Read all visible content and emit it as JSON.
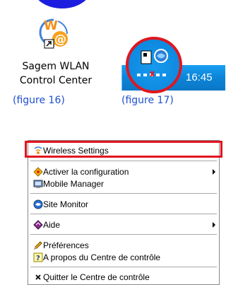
{
  "desktop_shortcut": {
    "label_line1": "Sagem WLAN",
    "label_line2": "Control Center",
    "icon": "wlan-shortcut-icon"
  },
  "captions": {
    "fig16": "(figure 16)",
    "fig17": "(figure 17)"
  },
  "tray": {
    "time": "16:45",
    "icon": "wlan-tray-icon"
  },
  "menu": {
    "items": [
      {
        "label": "Wireless Settings",
        "icon": "wireless-settings-icon"
      },
      {
        "label": "Activer la configuration",
        "icon": "activate-config-icon",
        "submenu": true
      },
      {
        "label": "Mobile Manager",
        "icon": "mobile-manager-icon"
      },
      {
        "label": "Site Monitor",
        "icon": "site-monitor-icon"
      },
      {
        "label": "Aide",
        "icon": "help-book-icon",
        "submenu": true
      },
      {
        "label": "Préférences",
        "icon": "pencil-icon"
      },
      {
        "label": "A propos du Centre de contrôle",
        "icon": "question-icon"
      },
      {
        "label": "Quitter le Centre de contrôle",
        "icon": "close-x-icon"
      }
    ]
  },
  "colors": {
    "highlight": "#e0161f",
    "caption": "#1f4fd0",
    "tray_blue": "#0c86d9"
  }
}
